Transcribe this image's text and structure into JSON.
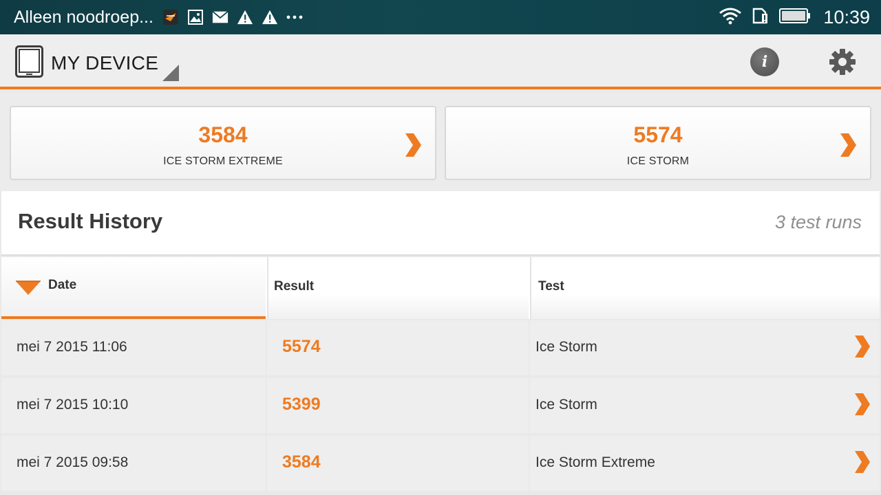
{
  "statusbar": {
    "title": "Alleen noodroep...",
    "time": "10:39",
    "notification_icons": [
      "game-app-icon",
      "image-icon",
      "mail-icon",
      "warning-icon",
      "warning-icon",
      "more-icon"
    ],
    "system_icons": [
      "wifi-icon",
      "sim-alert-icon",
      "battery-icon"
    ]
  },
  "actionbar": {
    "title": "MY DEVICE"
  },
  "cards": [
    {
      "score": "3584",
      "name": "ICE STORM EXTREME"
    },
    {
      "score": "5574",
      "name": "ICE STORM"
    }
  ],
  "history": {
    "title": "Result History",
    "count": "3 test runs"
  },
  "table": {
    "headers": {
      "date": "Date",
      "result": "Result",
      "test": "Test"
    },
    "rows": [
      {
        "date": "mei 7 2015 11:06",
        "result": "5574",
        "test": "Ice Storm"
      },
      {
        "date": "mei 7 2015 10:10",
        "result": "5399",
        "test": "Ice Storm"
      },
      {
        "date": "mei 7 2015 09:58",
        "result": "3584",
        "test": "Ice Storm Extreme"
      }
    ]
  },
  "colors": {
    "accent": "#ee7b22",
    "statusbar": "#12474f"
  }
}
